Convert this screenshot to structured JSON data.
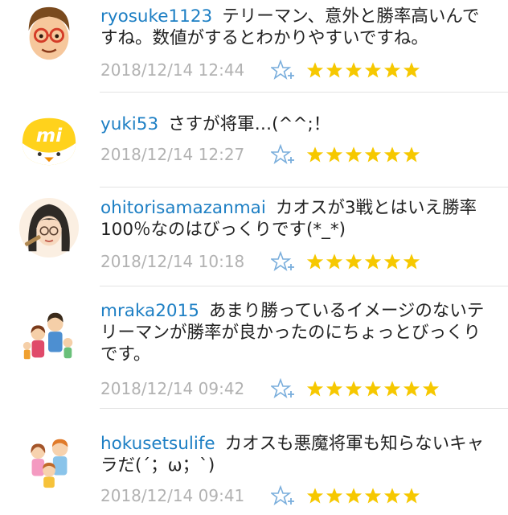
{
  "colors": {
    "username": "#1d7fc4",
    "text": "#222222",
    "timestamp": "#b2b2b2",
    "star_fill": "#f6c800",
    "fav_outline": "#7aaedc",
    "divider": "#e3e3e3"
  },
  "comments": [
    {
      "username": "ryosuke1123",
      "text": "テリーマン、意外と勝率高いんですね。数値がするとわかりやすいですね。",
      "timestamp": "2018/12/14 12:44",
      "stars": 6,
      "avatar": "glasses-man-avatar"
    },
    {
      "username": "yuki53",
      "text": "さすが将軍…(^^;！",
      "timestamp": "2018/12/14 12:27",
      "stars": 6,
      "avatar": "mi-chick-avatar"
    },
    {
      "username": "ohitorisamazanmai",
      "text": "カオスが3戦とはいえ勝率100％なのはびっくりです(*_*)",
      "timestamp": "2018/12/14 10:18",
      "stars": 6,
      "avatar": "long-hair-woman-avatar"
    },
    {
      "username": "mraka2015",
      "text": "あまり勝っているイメージのないテリーマンが勝率が良かったのにちょっとびっくりです。",
      "timestamp": "2018/12/14 09:42",
      "stars": 7,
      "avatar": "family-avatar"
    },
    {
      "username": "hokusetsulife",
      "text": "カオスも悪魔将軍も知らないキャラだ(´；ω；`)",
      "timestamp": "2018/12/14 09:41",
      "stars": 6,
      "avatar": "family-hug-avatar"
    }
  ]
}
